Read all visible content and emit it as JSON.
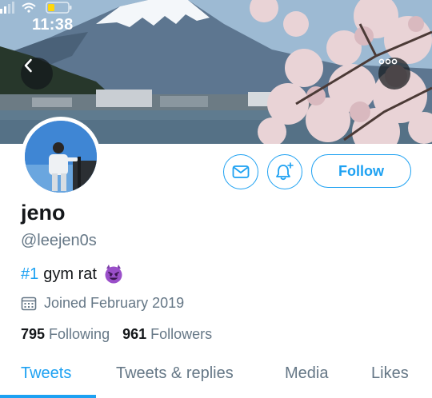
{
  "status_bar": {
    "time": "11:38",
    "icons": [
      "signal-icon",
      "wifi-icon",
      "battery-icon"
    ]
  },
  "header": {
    "back_icon": "chevron-left-icon",
    "more_icon": "more-dots-icon"
  },
  "profile": {
    "display_name": "jeno",
    "handle": "@leejen0s",
    "bio_hashtag": "#1",
    "bio_text": "gym rat",
    "bio_emoji": "smiling-imp-emoji",
    "joined": "Joined February 2019",
    "following_count": "795",
    "following_label": "Following",
    "followers_count": "961",
    "followers_label": "Followers"
  },
  "actions": {
    "message_icon": "envelope-icon",
    "notify_icon": "bell-plus-icon",
    "follow_label": "Follow"
  },
  "tabs": [
    {
      "label": "Tweets",
      "active": true
    },
    {
      "label": "Tweets & replies",
      "active": false
    },
    {
      "label": "Media",
      "active": false
    },
    {
      "label": "Likes",
      "active": false
    }
  ],
  "colors": {
    "accent": "#1da1f2",
    "secondary_text": "#657786",
    "primary_text": "#14171a"
  }
}
